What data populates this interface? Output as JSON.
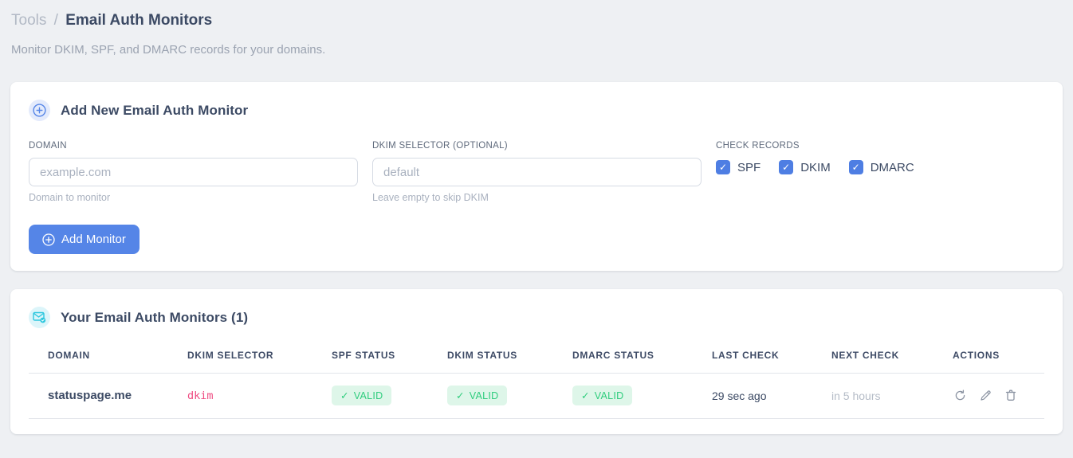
{
  "breadcrumb": {
    "section": "Tools",
    "separator": "/",
    "title": "Email Auth Monitors"
  },
  "subtitle": "Monitor DKIM, SPF, and DMARC records for your domains.",
  "ui": {
    "check_glyph": "✓"
  },
  "add_form": {
    "title": "Add New Email Auth Monitor",
    "fields": {
      "domain": {
        "label": "DOMAIN",
        "placeholder": "example.com",
        "value": "",
        "helper": "Domain to monitor"
      },
      "dkim_selector": {
        "label": "DKIM SELECTOR (OPTIONAL)",
        "placeholder": "default",
        "value": "",
        "helper": "Leave empty to skip DKIM"
      }
    },
    "check_records": {
      "label": "CHECK RECORDS",
      "options": [
        {
          "label": "SPF",
          "checked": true
        },
        {
          "label": "DKIM",
          "checked": true
        },
        {
          "label": "DMARC",
          "checked": true
        }
      ]
    },
    "submit_label": "Add Monitor"
  },
  "monitors": {
    "title": "Your Email Auth Monitors (1)",
    "table": {
      "columns": [
        "DOMAIN",
        "DKIM SELECTOR",
        "SPF STATUS",
        "DKIM STATUS",
        "DMARC STATUS",
        "LAST CHECK",
        "NEXT CHECK",
        "ACTIONS"
      ],
      "rows": [
        {
          "domain": "statuspage.me",
          "dkim_selector": "dkim",
          "spf_status": "VALID",
          "dkim_status": "VALID",
          "dmarc_status": "VALID",
          "last_check": "29 sec ago",
          "next_check": "in 5 hours"
        }
      ]
    }
  },
  "colors": {
    "accent_blue": "#5585e7",
    "checkbox_blue": "#4e7ee3",
    "badge_green_bg": "#def6e9",
    "badge_green_text": "#2fcd7d",
    "selector_pink": "#ee4b81",
    "icon_cyan": "#2cc7de",
    "page_bg": "#eef0f3"
  }
}
